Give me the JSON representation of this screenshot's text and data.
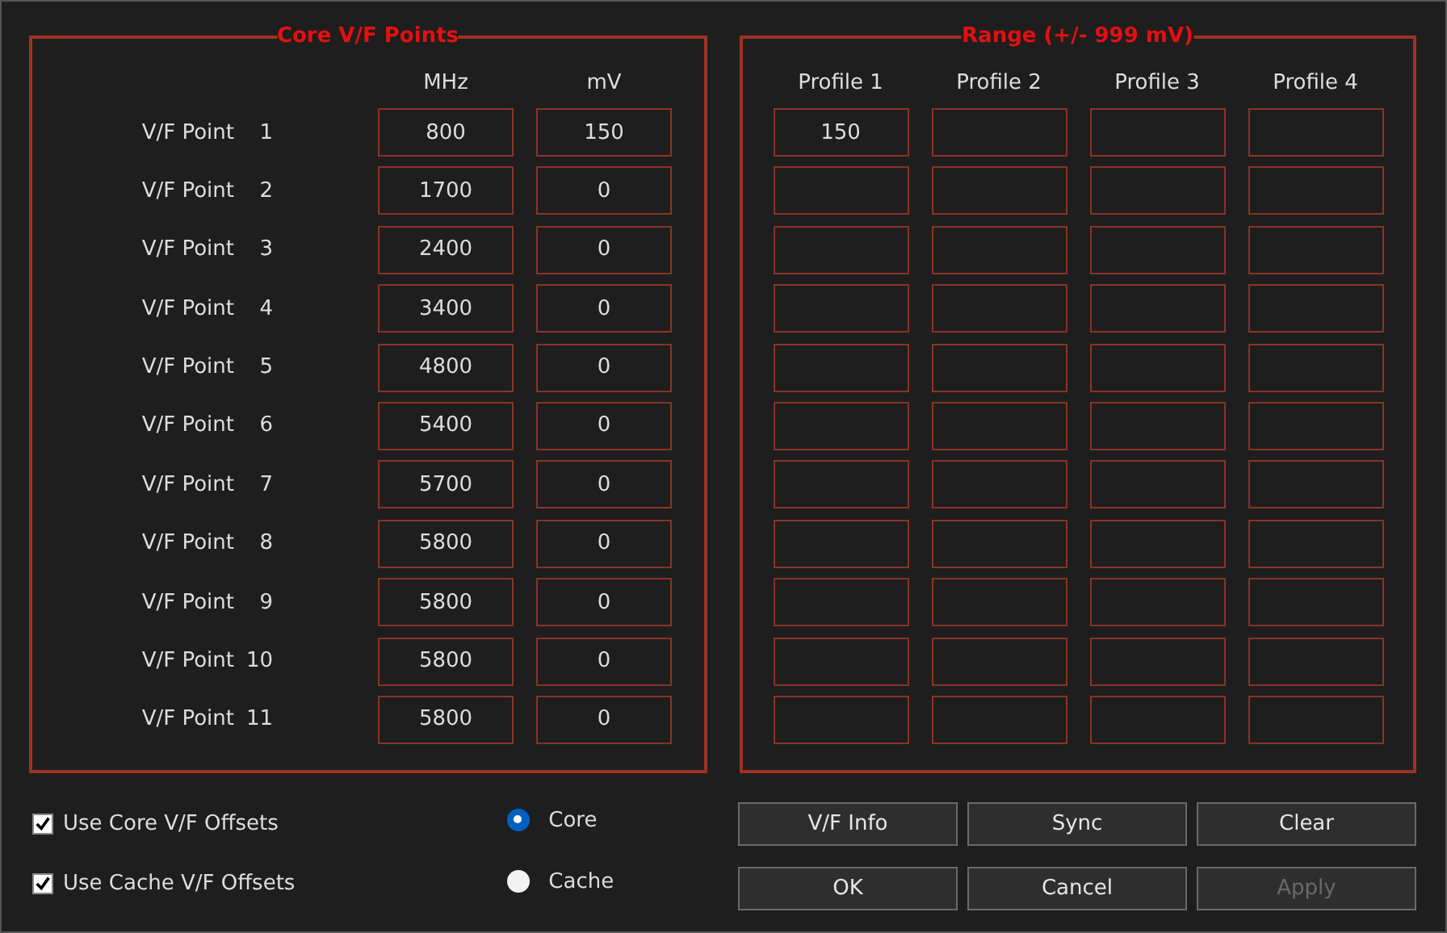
{
  "core_group": {
    "title": "Core V/F Points",
    "columns": [
      "MHz",
      "mV"
    ],
    "rows": [
      {
        "label": "V/F Point",
        "index": "1",
        "mhz": "800",
        "mv": "150",
        "profile_1": "150"
      },
      {
        "label": "V/F Point",
        "index": "2",
        "mhz": "1700",
        "mv": "0"
      },
      {
        "label": "V/F Point",
        "index": "3",
        "mhz": "2400",
        "mv": "0"
      },
      {
        "label": "V/F Point",
        "index": "4",
        "mhz": "3400",
        "mv": "0"
      },
      {
        "label": "V/F Point",
        "index": "5",
        "mhz": "4800",
        "mv": "0"
      },
      {
        "label": "V/F Point",
        "index": "6",
        "mhz": "5400",
        "mv": "0"
      },
      {
        "label": "V/F Point",
        "index": "7",
        "mhz": "5700",
        "mv": "0"
      },
      {
        "label": "V/F Point",
        "index": "8",
        "mhz": "5800",
        "mv": "0"
      },
      {
        "label": "V/F Point",
        "index": "9",
        "mhz": "5800",
        "mv": "0"
      },
      {
        "label": "V/F Point",
        "index": "10",
        "mhz": "5800",
        "mv": "0"
      },
      {
        "label": "V/F Point",
        "index": "11",
        "mhz": "5800",
        "mv": "0"
      }
    ]
  },
  "range_group": {
    "title": "Range (+/- 999 mV)",
    "columns": [
      "Profile 1",
      "Profile 2",
      "Profile 3",
      "Profile 4"
    ]
  },
  "checkboxes": [
    {
      "label": "Use Core V/F Offsets",
      "checked": true
    },
    {
      "label": "Use Cache V/F Offsets",
      "checked": true
    }
  ],
  "radios": [
    {
      "label": "Core",
      "selected": true
    },
    {
      "label": "Cache",
      "selected": false
    }
  ],
  "buttons": [
    {
      "label": "V/F Info",
      "disabled": false
    },
    {
      "label": "Sync",
      "disabled": false
    },
    {
      "label": "Clear",
      "disabled": false
    },
    {
      "label": "OK",
      "disabled": false
    },
    {
      "label": "Cancel",
      "disabled": false
    },
    {
      "label": "Apply",
      "disabled": true
    }
  ]
}
